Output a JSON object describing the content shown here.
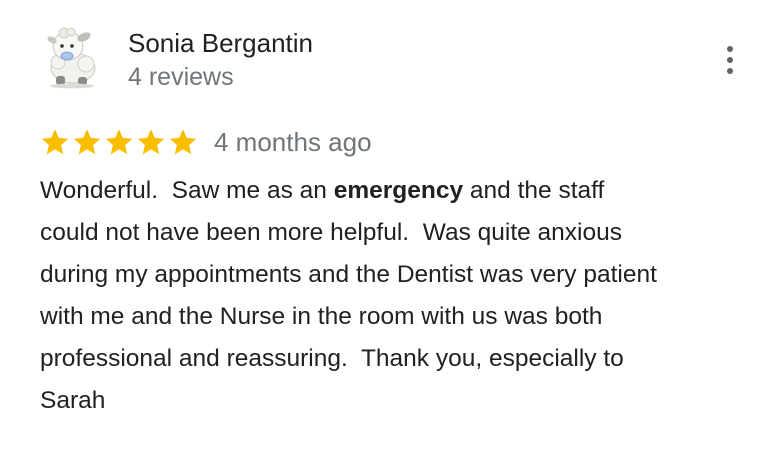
{
  "review": {
    "author_name": "Sonia Bergantin",
    "author_reviews": "4 reviews",
    "rating": 5,
    "rating_max": 5,
    "star_color": "#fbbc04",
    "date": "4 months ago",
    "avatar_icon": "sheep-avatar-icon",
    "more_icon": "more-vert-icon",
    "text": {
      "line1_before": "Wonderful.  Saw me as an ",
      "line1_bold": "emergency",
      "line1_after": " and the staff",
      "line2": "could not have been more helpful.  Was quite anxious",
      "line3": "during my appointments and the Dentist was very patient",
      "line4": "with me and the Nurse in the room with us was both",
      "line5": "professional and reassuring.  Thank you, especially to",
      "line6": "Sarah"
    }
  }
}
